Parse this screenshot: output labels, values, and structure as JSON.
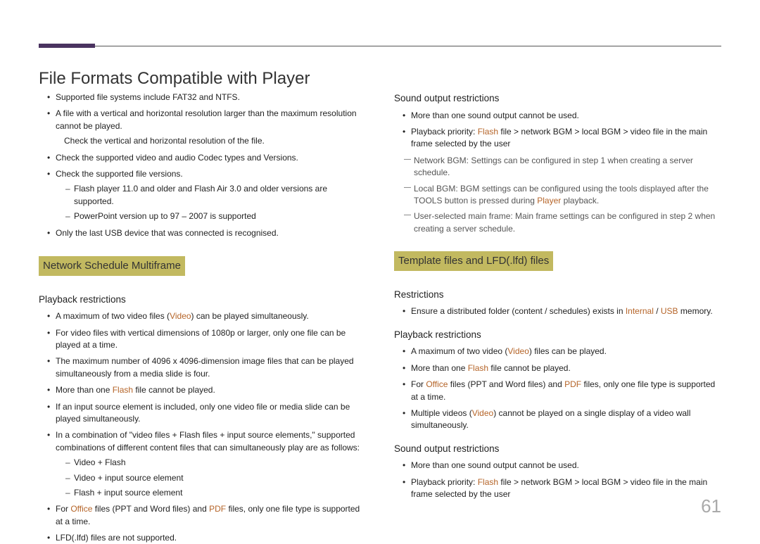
{
  "page_number": "61",
  "page_title": "File Formats Compatible with Player",
  "intro_bullets": [
    {
      "t": "Supported file systems include FAT32 and NTFS."
    },
    {
      "t": "A file with a vertical and horizontal resolution larger than the maximum resolution cannot be played.",
      "note": "Check the vertical and horizontal resolution of the file."
    },
    {
      "t": "Check the supported video and audio Codec types and Versions."
    },
    {
      "t": "Check the supported file versions.",
      "sub": [
        "Flash player 11.0 and older and Flash Air 3.0 and older versions are supported.",
        "PowerPoint version up to 97 – 2007 is supported"
      ]
    },
    {
      "t": "Only the last USB device that was connected is recognised."
    }
  ],
  "multiframe": {
    "heading": "Network Schedule Multiframe",
    "playback_h": "Playback restrictions",
    "playback": [
      {
        "pre": "A maximum of two video files (",
        "hl": "Video",
        "post": ") can be played simultaneously."
      },
      {
        "t": "For video files with vertical dimensions of 1080p or larger, only one file can be played at a time."
      },
      {
        "t": "The maximum number of 4096 x 4096-dimension image files that can be played simultaneously from a media slide is four."
      },
      {
        "pre": "More than one ",
        "hl": "Flash",
        "post": " file cannot be played."
      },
      {
        "t": "If an input source element is included, only one video file or media slide can be played simultaneously."
      },
      {
        "t": "In a combination of \"video files + Flash files + input source elements,\" supported combinations of different content files that can simultaneously play are as follows:",
        "sub": [
          "Video + Flash",
          "Video + input source element",
          "Flash + input source element"
        ]
      },
      {
        "pre": "For ",
        "hl": "Office",
        "mid": " files (PPT and Word files) and ",
        "hl2": "PDF",
        "post": " files, only one file type is supported at a time."
      },
      {
        "t": "LFD(.lfd) files are not supported."
      }
    ]
  },
  "sound": {
    "heading": "Sound output restrictions",
    "bullets": [
      {
        "t": "More than one sound output cannot be used."
      },
      {
        "pre": "Playback priority: ",
        "hl": "Flash",
        "post": " file > network BGM > local BGM > video file in the main frame selected by the user"
      }
    ],
    "subnotes": [
      "Network BGM: Settings can be configured in step 1 when creating a server schedule.",
      {
        "pre": "Local BGM: BGM settings can be configured using the tools displayed after the TOOLS button is pressed during ",
        "hl": "Player",
        "post": " playback."
      },
      "User-selected main frame: Main frame settings can be configured in step 2 when creating a server schedule."
    ]
  },
  "template": {
    "heading": "Template files and LFD(.lfd) files",
    "restrictions_h": "Restrictions",
    "restrictions": [
      {
        "pre": "Ensure a distributed folder (content / schedules) exists in ",
        "hl": "Internal",
        "mid": " / ",
        "hl2": "USB",
        "post": " memory."
      }
    ],
    "playback_h": "Playback restrictions",
    "playback": [
      {
        "pre": "A maximum of two video (",
        "hl": "Video",
        "post": ") files can be played."
      },
      {
        "pre": "More than one ",
        "hl": "Flash",
        "post": " file cannot be played."
      },
      {
        "pre": "For ",
        "hl": "Office",
        "mid": " files (PPT and Word files) and ",
        "hl2": "PDF",
        "post": " files, only one file type is supported at a time."
      },
      {
        "pre": "Multiple videos (",
        "hl": "Video",
        "post": ") cannot be played on a single display of a video wall simultaneously."
      }
    ],
    "sound_h": "Sound output restrictions",
    "sound": [
      {
        "t": "More than one sound output cannot be used."
      },
      {
        "pre": "Playback priority: ",
        "hl": "Flash",
        "post": " file > network BGM > local BGM > video file in the main frame selected by the user"
      }
    ]
  }
}
